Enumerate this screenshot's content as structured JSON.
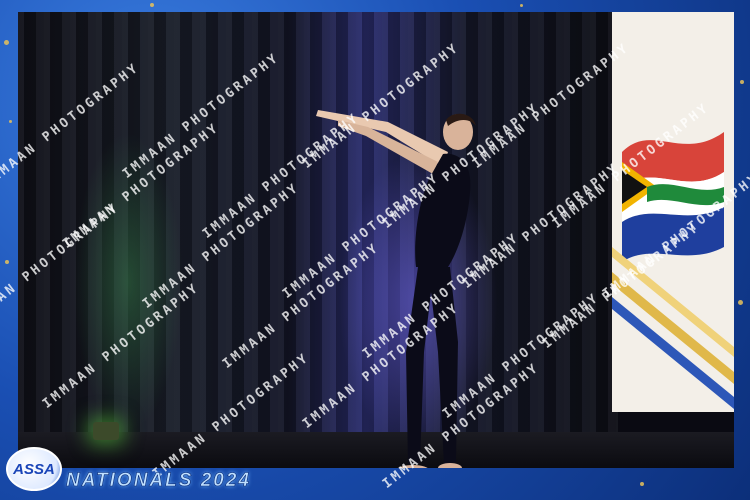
{
  "event": {
    "logo_text": "ASSA",
    "footer_title": "NATIONALS 2024"
  },
  "watermark": {
    "text": "IMMAAN PHOTOGRAPHY"
  },
  "colors": {
    "frame_blue": "#1a4fb3",
    "sparkle_gold": "#e8c25a",
    "stage_purple": "#6e64e6",
    "stage_green": "#3c8c50"
  }
}
